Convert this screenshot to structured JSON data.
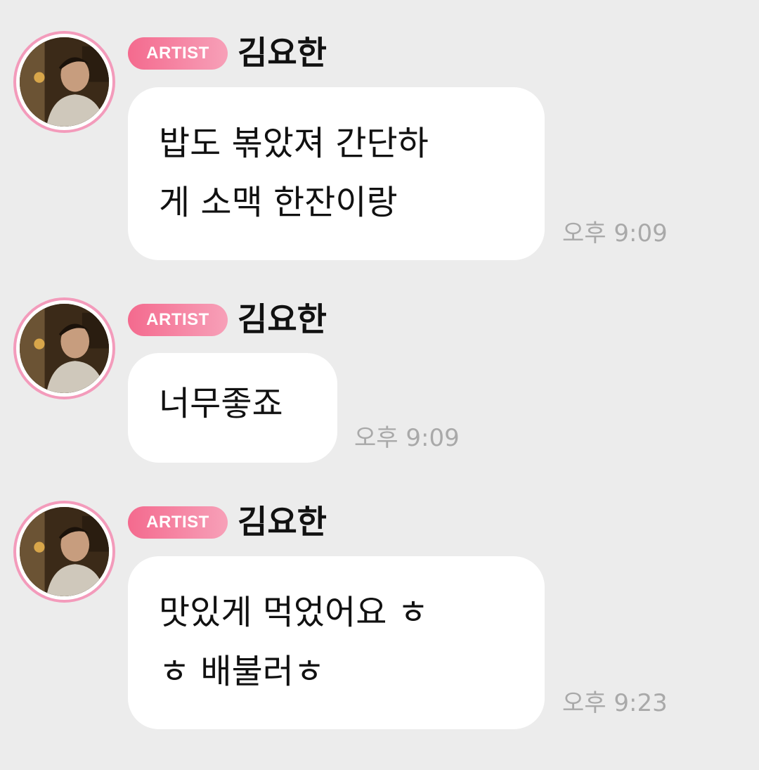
{
  "messages": [
    {
      "badge": "ARTIST",
      "sender": "김요한",
      "text": "밥도 볶았져 간단하\n게 소맥 한잔이랑",
      "time": "오후 9:09"
    },
    {
      "badge": "ARTIST",
      "sender": "김요한",
      "text": "너무좋죠",
      "time": "오후 9:09"
    },
    {
      "badge": "ARTIST",
      "sender": "김요한",
      "text": "맛있게 먹었어요 ㅎ\nㅎ 배불러ㅎ",
      "time": "오후 9:23"
    }
  ],
  "colors": {
    "background": "#ececec",
    "bubble": "#ffffff",
    "badge_start": "#f46a8e",
    "badge_end": "#f7a0b8",
    "avatar_ring": "#f39bbb",
    "time_text": "#a9a9a9"
  },
  "icons": {
    "avatar": "profile-photo"
  }
}
